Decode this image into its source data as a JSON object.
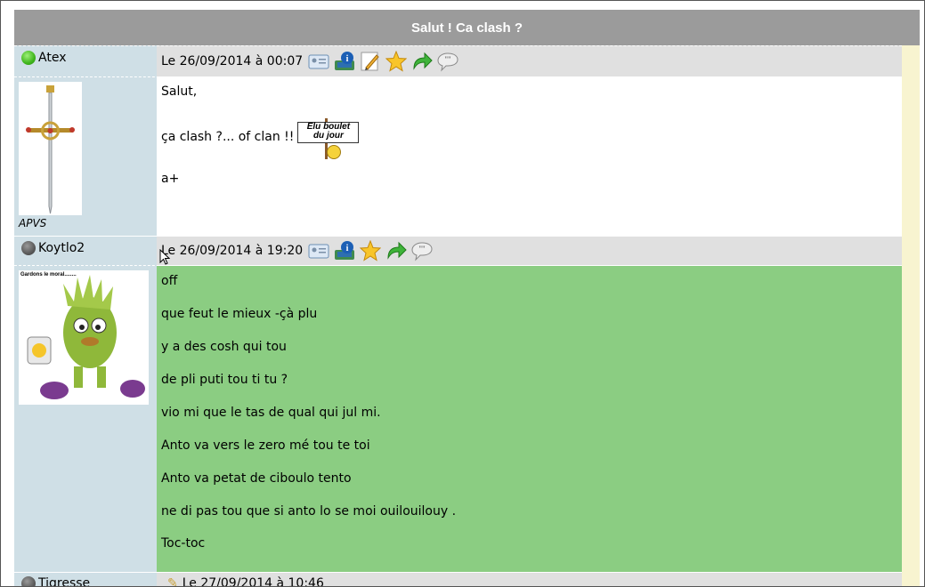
{
  "topic": {
    "title": "Salut ! Ca clash ?"
  },
  "posts": [
    {
      "author": "Atex",
      "status": "online",
      "date": "Le 26/09/2014 à 00:07",
      "rank": "APVS",
      "lines": [
        "Salut,",
        "ça clash ?... of clan !!",
        "a+"
      ],
      "sign_text": [
        "Elu boulet",
        "du jour"
      ],
      "actions": [
        "profile-icon",
        "info-icon",
        "edit-icon",
        "star-icon",
        "reply-icon",
        "quote-icon"
      ]
    },
    {
      "author": "Koytlo2",
      "status": "offline",
      "date": "Le 26/09/2014 à 19:20",
      "avatar_caption": "Gardons le moral........",
      "lines": [
        "off",
        "que feut le mieux -çà plu",
        "y a des cosh qui tou",
        "de pli puti tou ti tu ?",
        "vio mi que le tas de qual qui jul mi.",
        "Anto va vers le zero mé tou te toi",
        "Anto va petat de ciboulo tento",
        "ne di pas tou que si anto lo se moi ouilouilouy .",
        "Toc-toc"
      ],
      "actions": [
        "profile-icon",
        "info-icon",
        "star-icon",
        "reply-icon",
        "quote-icon"
      ]
    },
    {
      "author": "Tigresse",
      "status": "offline",
      "date": "Le 27/09/2014 à 10:46"
    }
  ],
  "colors": {
    "header_bg": "#9b9b9b",
    "sidebar_bg": "#cfdfe6",
    "meta_bg": "#e0e0e0",
    "post2_bg": "#8bcd82",
    "right_strip": "#f8f4d0"
  }
}
